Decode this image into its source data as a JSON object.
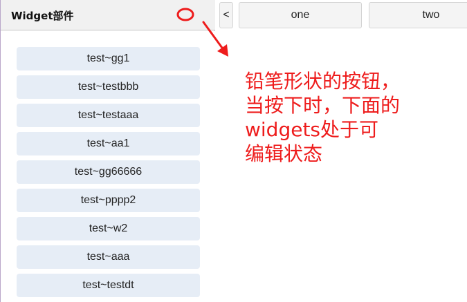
{
  "panel": {
    "title": "Widget部件"
  },
  "widgets": [
    "test~gg1",
    "test~testbbb",
    "test~testaaa",
    "test~aa1",
    "test~gg66666",
    "test~pppp2",
    "test~w2",
    "test~aaa",
    "test~testdt"
  ],
  "tabs": {
    "prev_label": "<",
    "one_label": "one",
    "two_label": "two"
  },
  "annotation": {
    "line1": "铅笔形状的按钮，",
    "line2": "当按下时，下面的",
    "line3": "widgets处于可",
    "line4": "编辑状态"
  },
  "colors": {
    "annotation": "#ee1c1c",
    "widget_bg": "#e6edf6"
  },
  "icons": {
    "pencil_button": "pencil-icon"
  }
}
